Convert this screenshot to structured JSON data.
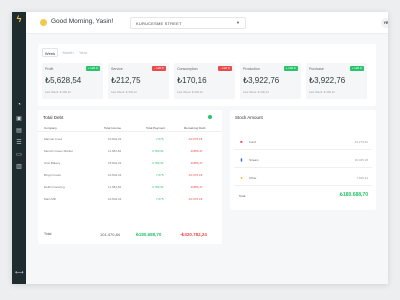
{
  "colors": {
    "sidebar": "#1e2b2f",
    "accent_green": "#27c46b",
    "accent_red": "#e84b4b",
    "logo": "#f5c04a"
  },
  "sidebar": {
    "logo_icon": "lightning-logo",
    "items": [
      {
        "icon": "pie-chart-icon",
        "active": true
      },
      {
        "icon": "trash-icon"
      },
      {
        "icon": "calendar-icon"
      },
      {
        "icon": "list-icon"
      },
      {
        "icon": "wallet-icon"
      },
      {
        "icon": "chart-icon"
      }
    ],
    "bottom_icon": "expand-icon"
  },
  "header": {
    "greeting": "Good Morning, Yasin!",
    "greeting_icon": "sun-icon",
    "location": "KURUCESME STREET",
    "avatar": "YE"
  },
  "period_tabs": [
    "Week",
    "Month",
    "Year"
  ],
  "stats": [
    {
      "label": "Profit",
      "badge": "+ 120 K",
      "badge_color": "#27c46b",
      "value": "₺5,628,54",
      "sub": "Last Week: ₺ 300,12"
    },
    {
      "label": "Service",
      "badge": "- 120 K",
      "badge_color": "#e84b4b",
      "value": "₺212,75",
      "sub": "Last Week: ₺ 300,12"
    },
    {
      "label": "Consumption",
      "badge": "- 120 K",
      "badge_color": "#e84b4b",
      "value": "₺170,16",
      "sub": "Last Week: ₺ 300,12"
    },
    {
      "label": "Production",
      "badge": "+ 120 K",
      "badge_color": "#27c46b",
      "value": "₺3,922,76",
      "sub": "Last Week: ₺ 300,12"
    },
    {
      "label": "Purchase",
      "badge": "+ 120 K",
      "badge_color": "#27c46b",
      "value": "₺3,922,76",
      "sub": "Last Week: ₺ 300,12"
    }
  ],
  "total_debt": {
    "title": "Total Debt",
    "headers": [
      "Company",
      "Total Income",
      "Total Payment",
      "Remaining Debt"
    ],
    "rows": [
      {
        "company": "Marmar Food",
        "income": "10.842,22",
        "payment": "7.075",
        "remaining": "-10.070,18"
      },
      {
        "company": "Menchi Green Market",
        "income": "11.681,82",
        "payment": "3.782,51",
        "remaining": "-8.880,47"
      },
      {
        "company": "Ulus Bakery",
        "income": "15.842,22",
        "payment": "3.782,51",
        "remaining": "-8.880,47"
      },
      {
        "company": "Bingo Foods",
        "income": "10.842,22",
        "payment": "7.075",
        "remaining": "-10.070,18"
      },
      {
        "company": "Delifi Grocering",
        "income": "11.681,82",
        "payment": "3.782,51",
        "remaining": "-8.880,47"
      },
      {
        "company": "Main Mill",
        "income": "10.842,22",
        "payment": "7.075",
        "remaining": "-10.070,18"
      }
    ],
    "total": {
      "label": "Total",
      "income": "101.470,84",
      "payment": "₺180.688,70",
      "remaining": "-₺320.782,24"
    }
  },
  "stock": {
    "title": "Stock Amount",
    "rows": [
      {
        "icon": "car-icon",
        "icon_color": "#e84b4b",
        "name": "Fund",
        "value": "23.279,52"
      },
      {
        "icon": "bottle-icon",
        "icon_color": "#3b6bd6",
        "name": "Stream",
        "value": "20.025,18"
      },
      {
        "icon": "drop-icon",
        "icon_color": "#f5b400",
        "name": "Other",
        "value": "7.936,24"
      }
    ],
    "total_label": "Total",
    "total_value": "₺180.688,70"
  }
}
